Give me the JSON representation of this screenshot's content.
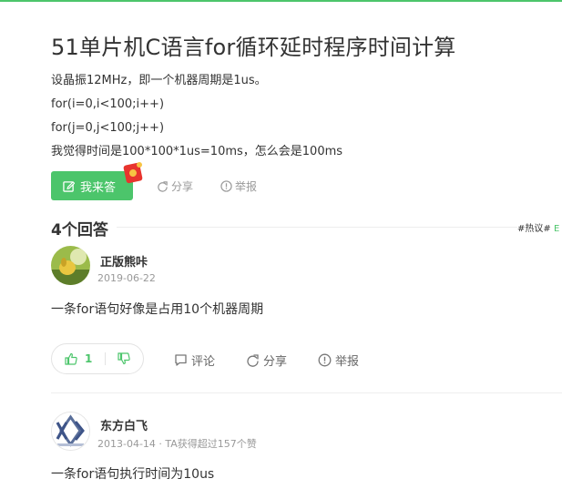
{
  "question": {
    "title": "51单片机C语言for循环延时程序时间计算",
    "lines": [
      "设晶振12MHz，即一个机器周期是1us。",
      "for(i=0,i<100;i++)",
      "for(j=0,j<100;j++)",
      "我觉得时间是100*100*1us=10ms，怎么会是100ms"
    ]
  },
  "actions": {
    "answer_label": "我来答",
    "share_label": "分享",
    "report_label": "举报"
  },
  "answers_header": {
    "count_label": "4个回答",
    "tags": "#热议#",
    "tags_extra": "E"
  },
  "answers": [
    {
      "author": "正版熊咔",
      "meta": "2019-06-22",
      "text": "一条for语句好像是占用10个机器周期",
      "likes": "1",
      "comment_label": "评论",
      "share_label": "分享",
      "report_label": "举报"
    },
    {
      "author": "东方白飞",
      "meta": "2013-04-14 · TA获得超过157个赞",
      "text": "一条for语句执行时间为10us"
    }
  ],
  "colors": {
    "accent": "#4cc56b",
    "muted": "#999999",
    "text": "#333333"
  },
  "icons": [
    "pen-icon",
    "red-packet-icon",
    "share-icon",
    "report-icon",
    "thumb-up-icon",
    "thumb-down-icon",
    "comment-icon"
  ]
}
